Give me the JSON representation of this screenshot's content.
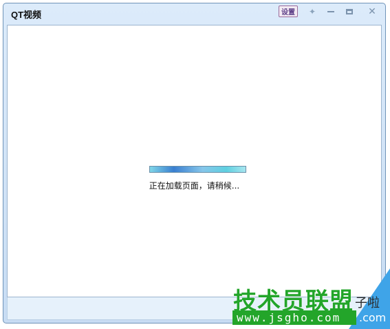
{
  "window": {
    "title": "QT视频",
    "buttons": {
      "settings_label": "设置",
      "pin_icon": "pin-icon",
      "minimize_icon": "minimize-icon",
      "maximize_icon": "maximize-icon",
      "close_icon": "close-icon"
    }
  },
  "content": {
    "loading_text": "正在加载页面，请稍候...",
    "progress_percent": 100
  },
  "watermark": {
    "title": "技术员联盟",
    "url": "www.jsgho.com",
    "overlay_text_1": "子啦",
    "overlay_text_2": ".com"
  },
  "colors": {
    "title_bar": "#dcebfa",
    "progress": "#3a7fd0",
    "watermark_green": "#23a52a",
    "watermark_blue": "#3fa4e8"
  }
}
